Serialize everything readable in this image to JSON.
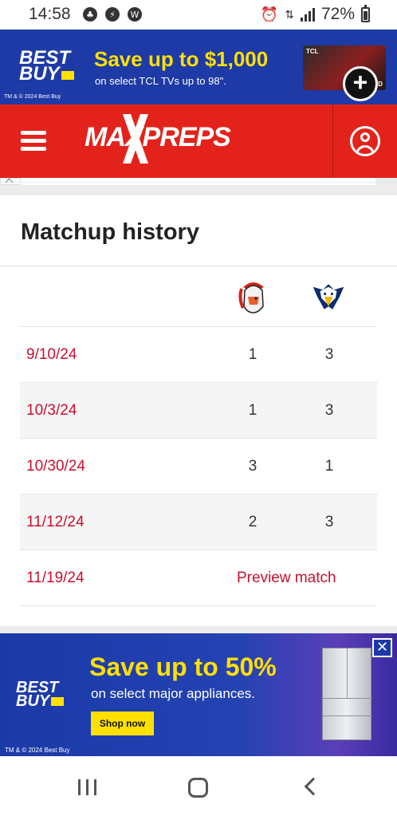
{
  "status_bar": {
    "time": "14:58",
    "battery": "72%",
    "battery_level": 0.72
  },
  "ad_top": {
    "brand_line1": "BEST",
    "brand_line2": "BUY",
    "headline": "Save up to $1,000",
    "subtext": "on select TCL TVs up to 98\".",
    "legal": "TM & © 2024 Best Buy",
    "tv_brand": "TCL",
    "tv_label": "OLED",
    "expand_icon": "plus-circle-icon"
  },
  "header": {
    "menu_icon": "hamburger-icon",
    "logo": "MAXPREPS",
    "account_icon": "user-icon",
    "color": "#e3231b"
  },
  "matchup": {
    "title": "Matchup history",
    "home_team_icon": "spartan-helmet-icon",
    "away_team_icon": "eagle-icon",
    "games": [
      {
        "date": "9/10/24",
        "home_score": "1",
        "away_score": "3"
      },
      {
        "date": "10/3/24",
        "home_score": "1",
        "away_score": "3"
      },
      {
        "date": "10/30/24",
        "home_score": "3",
        "away_score": "1"
      },
      {
        "date": "11/12/24",
        "home_score": "2",
        "away_score": "3"
      }
    ],
    "upcoming": {
      "date": "11/19/24",
      "label": "Preview match"
    },
    "accent_color": "#c8102e"
  },
  "ad_bottom": {
    "brand_line1": "BEST",
    "brand_line2": "BUY",
    "headline": "Save up to 50%",
    "subtext": "on select major appliances.",
    "cta": "Shop now",
    "legal": "TM & © 2024 Best Buy",
    "close_icon": "close-icon"
  },
  "nav_bar": {
    "recent_icon": "recent-apps-icon",
    "home_icon": "home-icon",
    "back_icon": "back-icon"
  }
}
